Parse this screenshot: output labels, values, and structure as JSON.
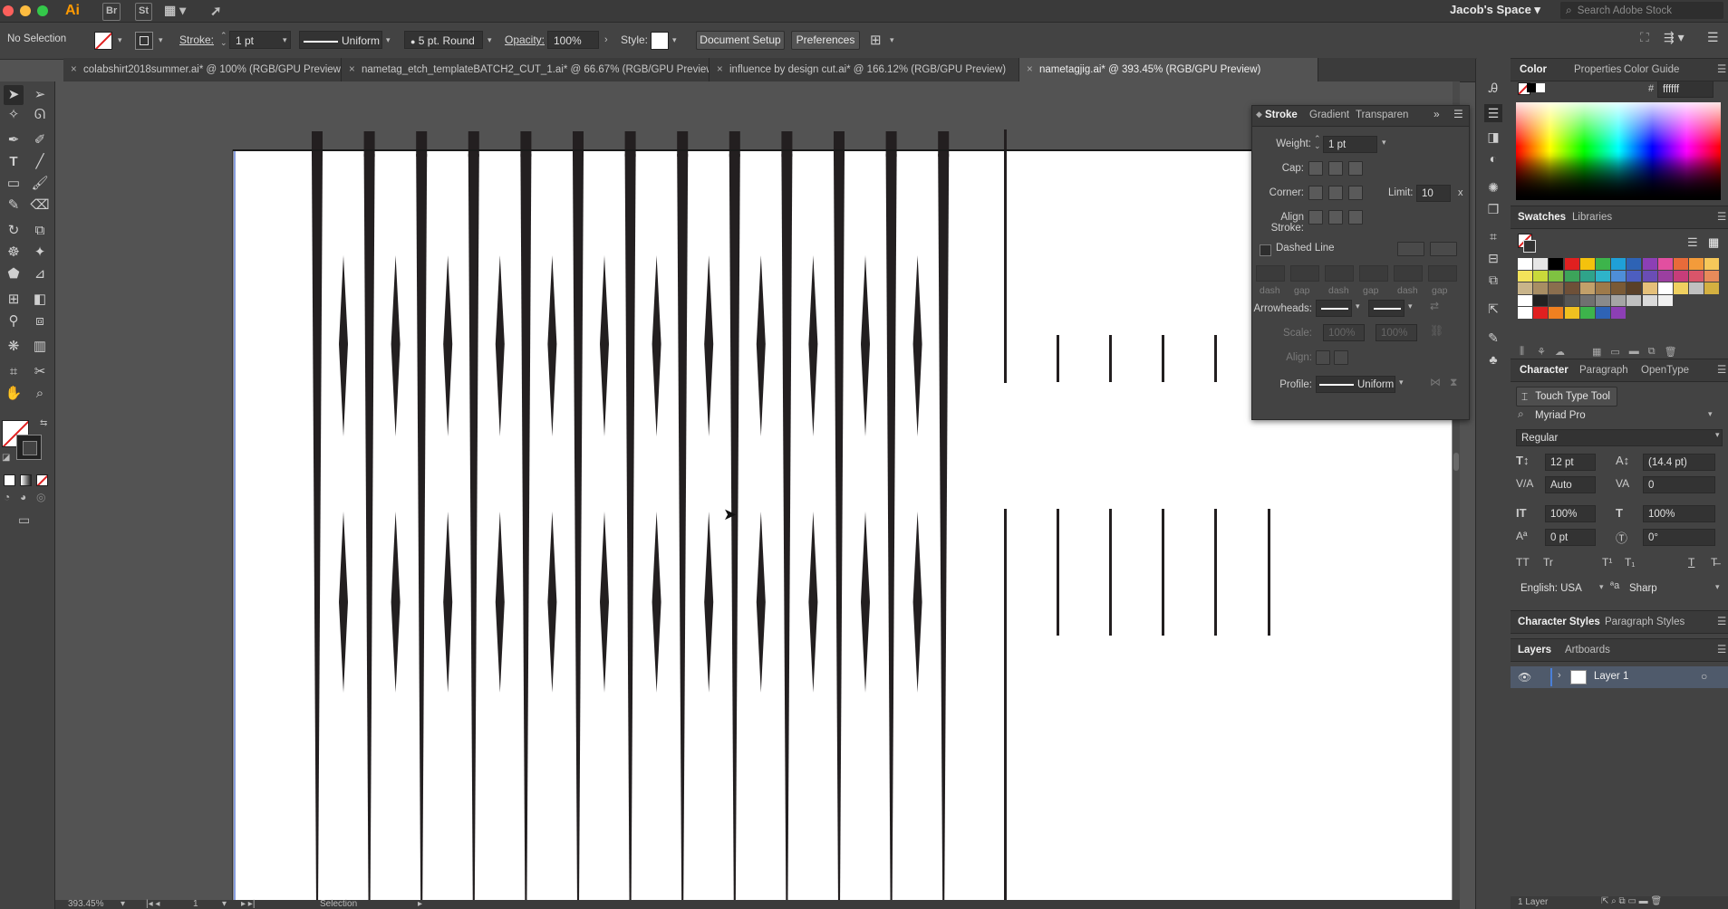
{
  "menubar": {
    "app_logo": "Ai",
    "bridge": "Br",
    "stock": "St",
    "workspace": "Jacob's Space",
    "search_placeholder": "Search Adobe Stock"
  },
  "control_bar": {
    "selection_status": "No Selection",
    "stroke_label": "Stroke:",
    "stroke_weight": "1 pt",
    "profile": "Uniform",
    "brush": "5 pt. Round",
    "opacity_label": "Opacity:",
    "opacity": "100%",
    "style_label": "Style:",
    "document_setup": "Document Setup",
    "preferences": "Preferences"
  },
  "tabs": [
    {
      "label": "colabshirt2018summer.ai* @ 100% (RGB/GPU Preview)",
      "active": false
    },
    {
      "label": "nametag_etch_templateBATCH2_CUT_1.ai* @ 66.67% (RGB/GPU Preview)",
      "active": false
    },
    {
      "label": "influence by design cut.ai* @ 166.12% (RGB/GPU Preview)",
      "active": false
    },
    {
      "label": "nametagjig.ai* @ 393.45% (RGB/GPU Preview)",
      "active": true
    }
  ],
  "stroke_panel": {
    "tabs": [
      "Stroke",
      "Gradient",
      "Transparen"
    ],
    "weight_label": "Weight:",
    "weight": "1 pt",
    "cap_label": "Cap:",
    "corner_label": "Corner:",
    "limit_label": "Limit:",
    "limit": "10",
    "limit_unit": "x",
    "align_label": "Align Stroke:",
    "dashed_label": "Dashed Line",
    "dash_labels": [
      "dash",
      "gap",
      "dash",
      "gap",
      "dash",
      "gap"
    ],
    "arrowheads_label": "Arrowheads:",
    "scale_label": "Scale:",
    "scale_values": [
      "100%",
      "100%"
    ],
    "align_arrow_label": "Align:",
    "profile_label": "Profile:",
    "profile": "Uniform"
  },
  "color_panel": {
    "tabs": [
      "Color",
      "Properties",
      "Color Guide"
    ],
    "hex_symbol": "#",
    "hex": "ffffff"
  },
  "swatches_panel": {
    "tabs": [
      "Swatches",
      "Libraries"
    ]
  },
  "character_panel": {
    "tabs": [
      "Character",
      "Paragraph",
      "OpenType"
    ],
    "touch_type": "Touch Type Tool",
    "font": "Myriad Pro",
    "style": "Regular",
    "size": "12 pt",
    "leading": "(14.4 pt)",
    "kerning": "Auto",
    "tracking": "0",
    "vscale": "100%",
    "hscale": "100%",
    "baseline": "0 pt",
    "rotation": "0°",
    "caps_buttons": [
      "TT",
      "Tr",
      "T¹",
      "T₁",
      "T",
      "T̶"
    ],
    "language": "English: USA",
    "aa_icon": "ªa",
    "antialias": "Sharp"
  },
  "styles_tabs": [
    "Character Styles",
    "Paragraph Styles"
  ],
  "layers_panel": {
    "tabs": [
      "Layers",
      "Artboards"
    ],
    "layer_name": "Layer 1",
    "count": "1 Layer"
  },
  "status_bar": {
    "zoom": "393.45%",
    "artboard": "1",
    "tool": "Selection"
  },
  "colors": {
    "ui_bg": "#535353",
    "panel_bg": "#434343",
    "artboard": "#ffffff",
    "spike": "#231f20",
    "layer_color": "#4a7fd8"
  }
}
